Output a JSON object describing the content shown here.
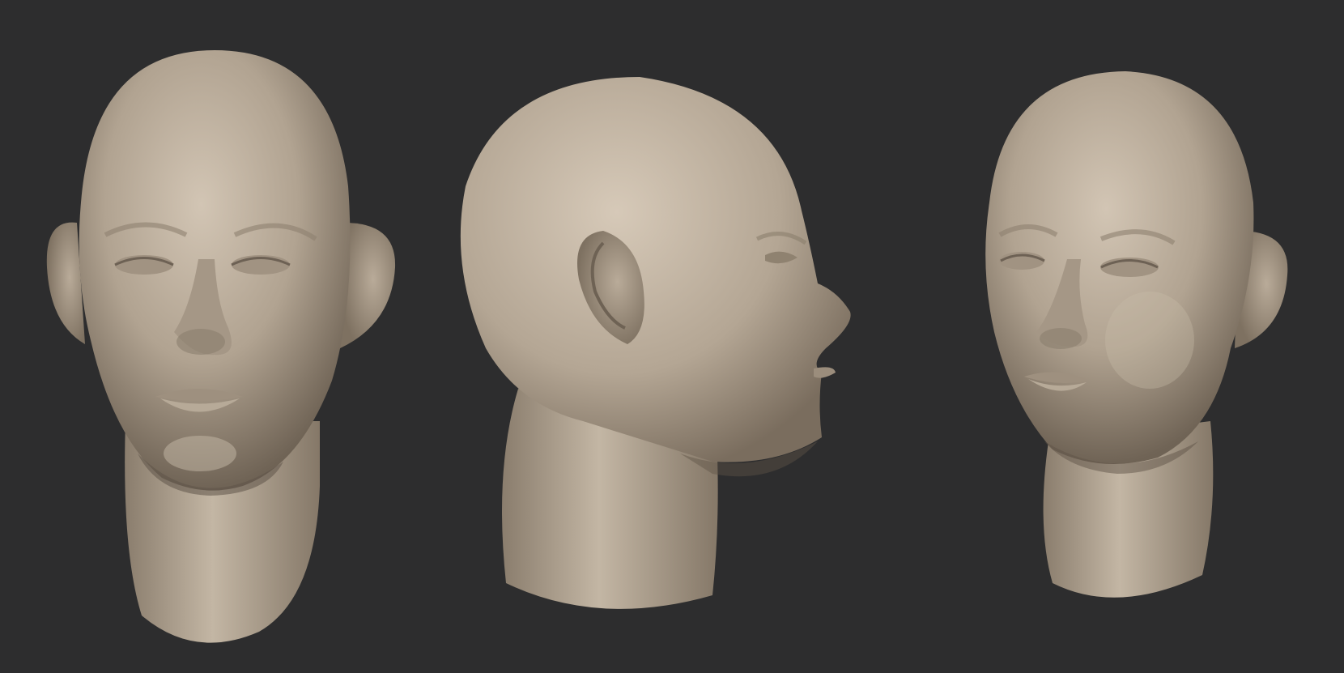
{
  "scene": {
    "background_color": "#2d2d2e",
    "material_color": "#b4a695",
    "material_highlight": "#cfc2b1",
    "material_shadow": "#6e6254",
    "views": [
      {
        "name": "front",
        "icon": "head-front-view"
      },
      {
        "name": "side",
        "icon": "head-side-view"
      },
      {
        "name": "three-quarter",
        "icon": "head-three-quarter-view"
      }
    ]
  }
}
